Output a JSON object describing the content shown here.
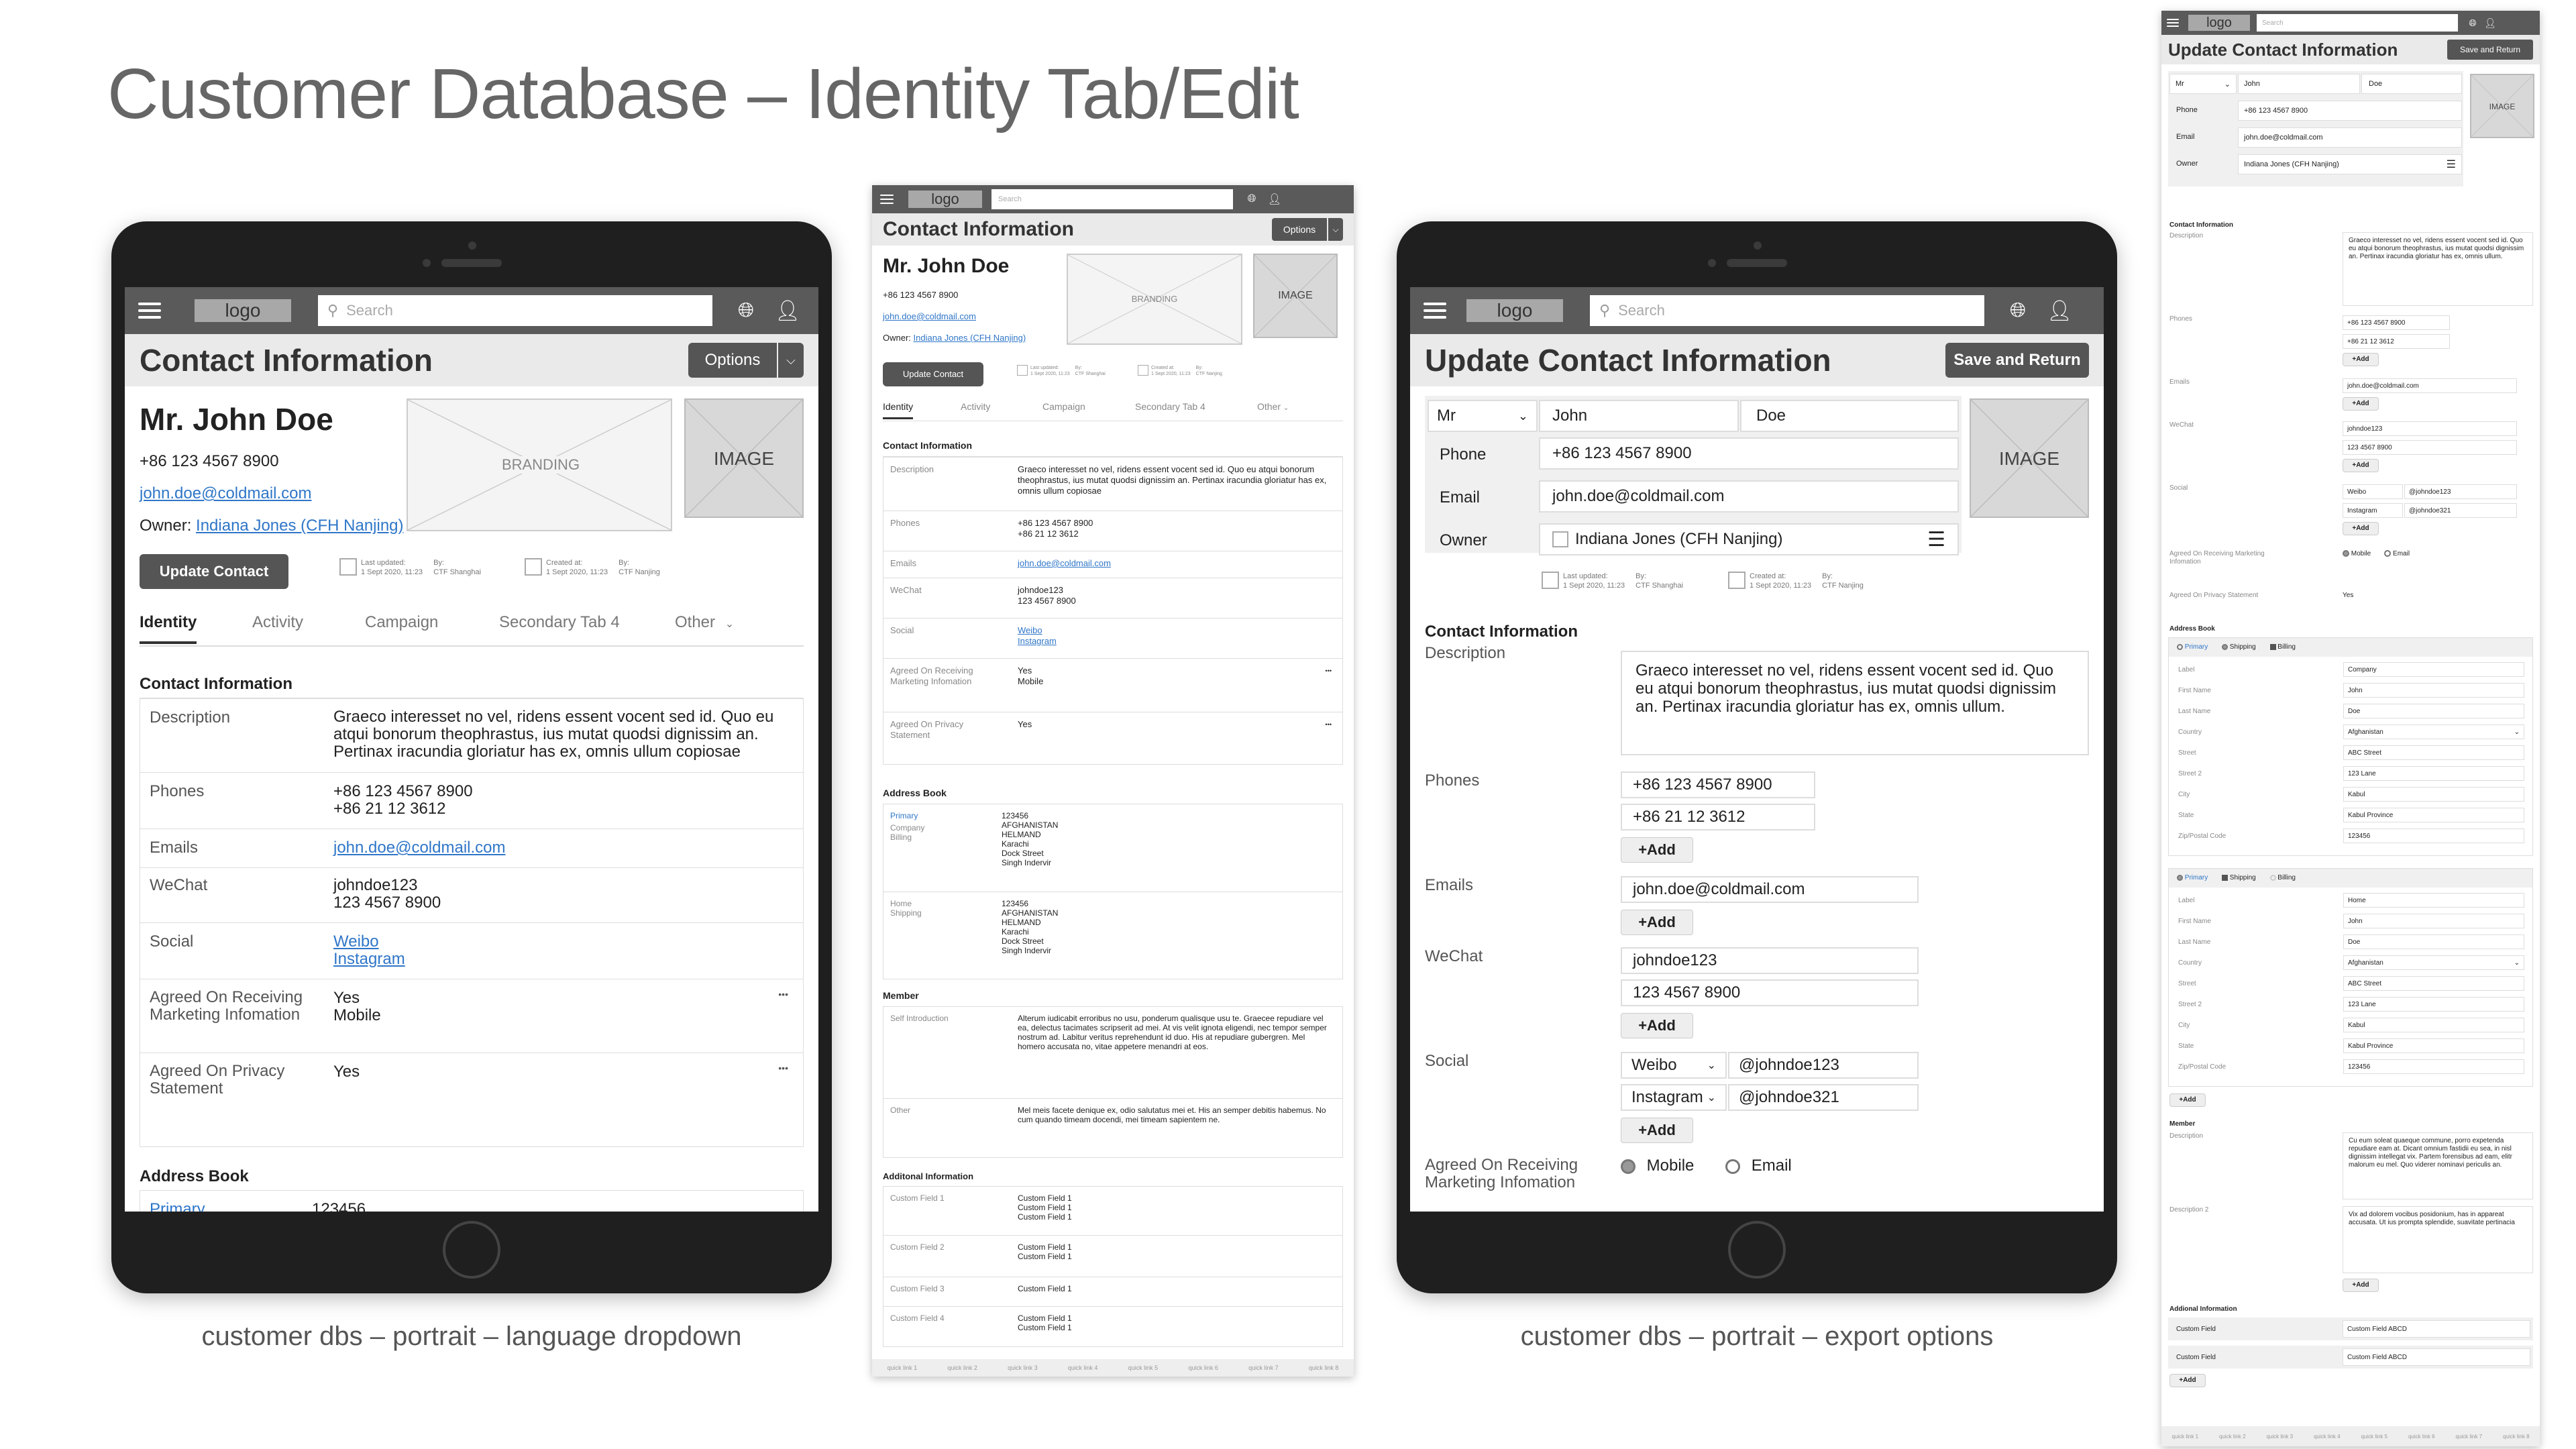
{
  "page_title": "Customer Database – Identity Tab/Edit",
  "captions": {
    "left": "customer dbs – portrait – language dropdown",
    "right": "customer dbs – portrait – export options"
  },
  "nav": {
    "logo": "logo",
    "search_placeholder": "Search",
    "globe_icon": "globe-icon",
    "user_icon": "user-icon",
    "menu_icon": "hamburger-icon"
  },
  "contact_view": {
    "title": "Contact Information",
    "options_label": "Options",
    "name": "Mr. John Doe",
    "phone": "+86 123 4567 8900",
    "email": "john.doe@coldmail.com",
    "owner_label": "Owner:",
    "owner": "Indiana Jones (CFH Nanjing)",
    "branding": "BRANDING",
    "image": "IMAGE",
    "update_button": "Update Contact",
    "last_updated_label": "Last updated:",
    "last_updated": "1 Sept 2020, 11:23",
    "by_label": "By:",
    "updated_by": "CTF Shanghai",
    "created_label": "Created at:",
    "created_at": "1 Sept 2020, 11:23",
    "created_by": "CTF Nanjing",
    "tabs": [
      "Identity",
      "Activity",
      "Campaign",
      "Secondary Tab 4",
      "Other"
    ],
    "section_contact": "Contact Information",
    "rows": {
      "description_label": "Description",
      "description": "Graeco interesset no vel, ridens essent vocent sed id. Quo eu atqui bonorum theophrastus, ius mutat quodsi dignissim an. Pertinax iracundia gloriatur has ex, omnis ullum copiosae",
      "phones_label": "Phones",
      "phone1": "+86 123 4567 8900",
      "phone2": "+86 21 12 3612",
      "emails_label": "Emails",
      "email": "john.doe@coldmail.com",
      "wechat_label": "WeChat",
      "wechat1": "johndoe123",
      "wechat2": "123 4567 8900",
      "social_label": "Social",
      "social1": "Weibo",
      "social2": "Instagram",
      "marketing_label": "Agreed On Receiving Marketing Infomation",
      "marketing1": "Yes",
      "marketing2": "Mobile",
      "privacy_label": "Agreed On Privacy Statement",
      "privacy": "Yes",
      "more": "•••"
    },
    "address_book": "Address Book",
    "address_primary": "Primary",
    "address_company": "Company",
    "address_billing": "Billing",
    "address_home": "Home",
    "address_shipping": "Shipping",
    "address_lines": [
      "123456",
      "AFGHANISTAN",
      "HELMAND",
      "Karachi",
      "Dock Street",
      "Singh Indervir"
    ],
    "member": "Member",
    "self_intro_label": "Self Introduction",
    "self_intro": "Alterum iudicabit erroribus no usu, ponderum qualisque usu te. Graecee repudiare vel ea, delectus tacimates scripserit ad mei. At vis velit ignota eligendi, nec tempor semper nostrum ad. Labitur veritus reprehendunt id duo. His at repudiare gubergren. Mel homero accusata no, vitae appetere menandri at eos.",
    "other_label": "Other",
    "other": "Mel meis facete denique ex, odio salutatus mei et. His an semper debitis habemus. No cum quando timeam docendi, mei timeam sapientem ne.",
    "additional": "Additonal Information",
    "custom": [
      {
        "label": "Custom Field 1",
        "vals": [
          "Custom Field 1",
          "Custom Field 1",
          "Custom Field 1"
        ]
      },
      {
        "label": "Custom Field 2",
        "vals": [
          "Custom Field 1",
          "Custom Field 1"
        ]
      },
      {
        "label": "Custom Field 3",
        "vals": [
          "Custom Field 1"
        ]
      },
      {
        "label": "Custom Field 4",
        "vals": [
          "Custom Field 1",
          "Custom Field 1"
        ]
      }
    ],
    "quick_links": [
      "quick link 1",
      "quick link 2",
      "quick link 3",
      "quick link 4",
      "quick link 5",
      "quick link 6",
      "quick link 7",
      "quick link 8"
    ]
  },
  "edit_view": {
    "title": "Update Contact Information",
    "save_button": "Save and Return",
    "salutation": "Mr",
    "first_name": "John",
    "last_name": "Doe",
    "phone_label": "Phone",
    "phone": "+86 123 4567 8900",
    "email_label": "Email",
    "email": "john.doe@coldmail.com",
    "owner_label": "Owner",
    "owner": "Indiana Jones (CFH Nanjing)",
    "image": "IMAGE",
    "section_contact": "Contact Information",
    "description_label": "Description",
    "description": "Graeco interesset no vel, ridens essent vocent sed id. Quo eu atqui bonorum theophrastus, ius mutat quodsi dignissim an. Pertinax iracundia gloriatur has ex, omnis ullum.",
    "phones_label": "Phones",
    "phone1": "+86 123 4567 8900",
    "phone2": "+86 21 12 3612",
    "add": "+Add",
    "emails_label": "Emails",
    "email1": "john.doe@coldmail.com",
    "wechat_label": "WeChat",
    "wechat1": "johndoe123",
    "wechat2": "123 4567 8900",
    "social_label": "Social",
    "social1_net": "Weibo",
    "social1_handle": "@johndoe123",
    "social2_net": "Instagram",
    "social2_handle": "@johndoe321",
    "marketing_label": "Agreed On Receiving Marketing Infomation",
    "opt_mobile": "Mobile",
    "opt_email": "Email",
    "privacy_label": "Agreed On Privacy Statement",
    "privacy": "Yes",
    "address_book": "Address Book",
    "addr_tabs": [
      "Primary",
      "Shipping",
      "Billing"
    ],
    "addr_labels": [
      "Label",
      "First Name",
      "Last Name",
      "Country",
      "Street",
      "Street 2",
      "City",
      "State",
      "Zip/Postal Code"
    ],
    "addr1_vals": [
      "Company",
      "John",
      "Doe",
      "Afghanistan",
      "ABC Street",
      "123 Lane",
      "Kabul",
      "Kabul Province",
      "123456"
    ],
    "addr2_vals": [
      "Home",
      "John",
      "Doe",
      "Afghanistan",
      "ABC Street",
      "123 Lane",
      "Kabul",
      "Kabul Province",
      "123456"
    ],
    "member": "Member",
    "member_desc_label": "Description",
    "member_desc": "Cu eum soleat quaeque commune, porro expetenda repudiare eam at. Dicant omnium fastidii eu sea, in nisl dignissim intellegat vix. Partem forensibus ad eam, elitr malorum eu mel. Quo viderer nominavi periculis an.",
    "member_desc2_label": "Description 2",
    "member_desc2": "Vix ad dolorem vocibus posidonium, has in appareat accusata. Ut ius prompta splendide, suavitate pertinacia",
    "additional": "Addional Information",
    "custom_label": "Custom Field",
    "custom_val": "Custom Field ABCD"
  }
}
